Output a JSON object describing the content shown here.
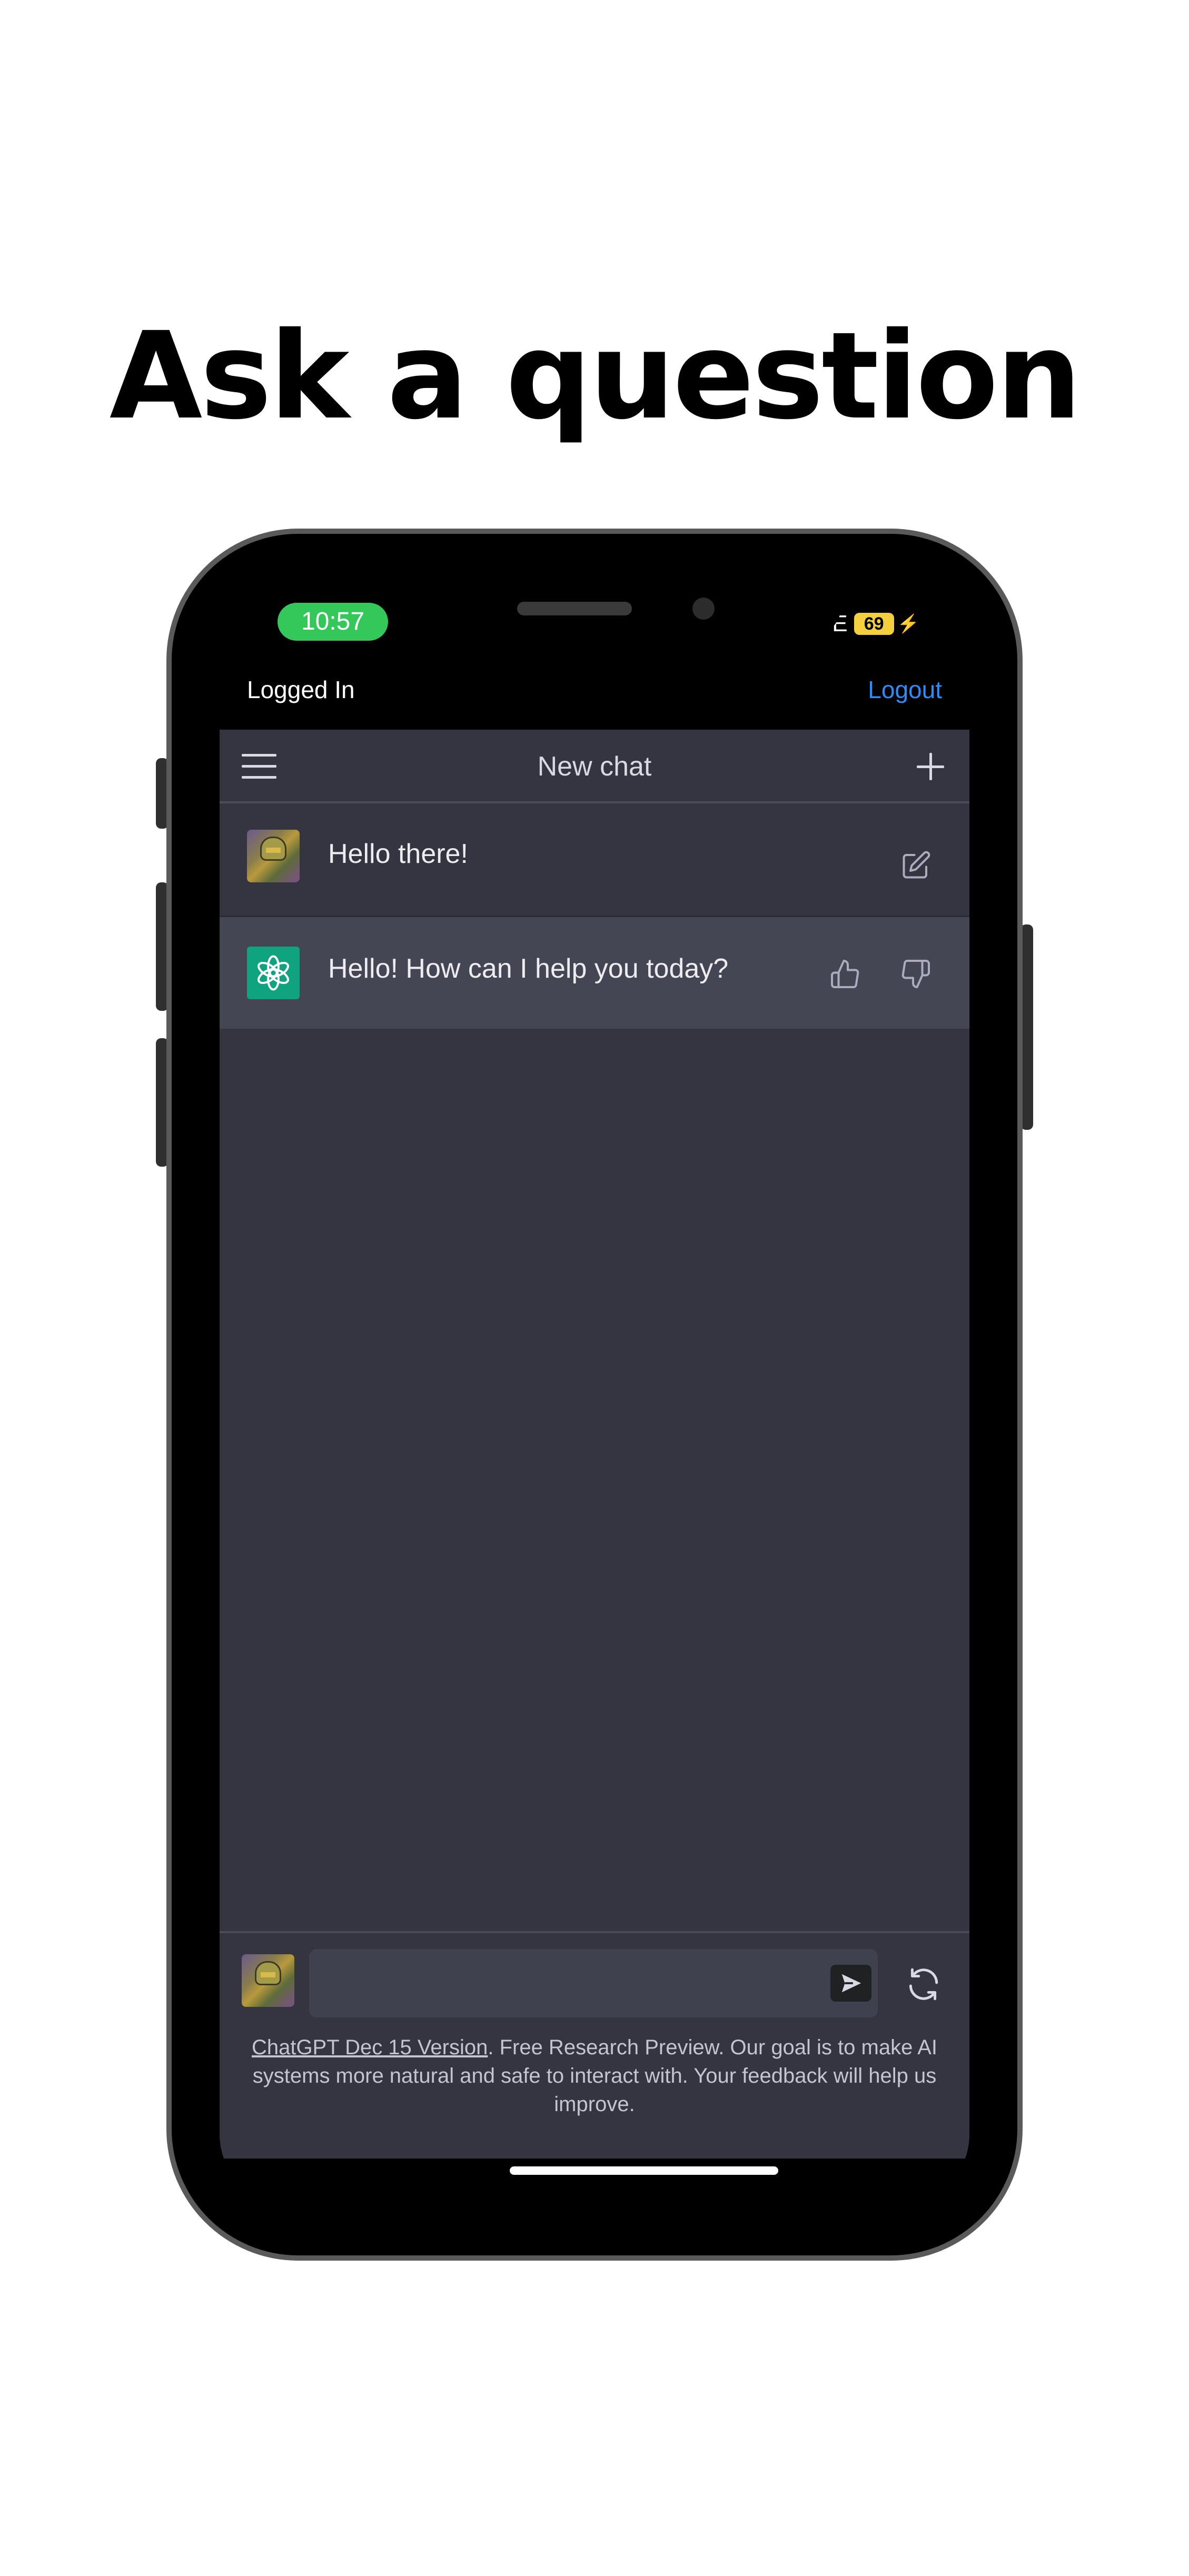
{
  "headline": "Ask a question",
  "status_bar": {
    "time": "10:57",
    "network": "LTE",
    "battery": "69"
  },
  "app_header": {
    "status": "Logged In",
    "logout": "Logout"
  },
  "navbar": {
    "title": "New chat"
  },
  "messages": [
    {
      "role": "user",
      "text": "Hello there!"
    },
    {
      "role": "assistant",
      "text": "Hello! How can I help you today?"
    }
  ],
  "input": {
    "value": "",
    "placeholder": ""
  },
  "footer": {
    "version_link": "ChatGPT Dec 15 Version",
    "text": ". Free Research Preview. Our goal is to make AI systems more natural and safe to interact with. Your feedback will help us improve."
  },
  "colors": {
    "accent_green": "#10a37f",
    "status_green": "#34c759",
    "link_blue": "#2f8bf5",
    "chat_background": "#343541",
    "assistant_row": "#444654"
  },
  "icons": [
    "hamburger-menu-icon",
    "plus-icon",
    "edit-icon",
    "thumbs-up-icon",
    "thumbs-down-icon",
    "openai-logo-icon",
    "send-icon",
    "refresh-icon"
  ]
}
